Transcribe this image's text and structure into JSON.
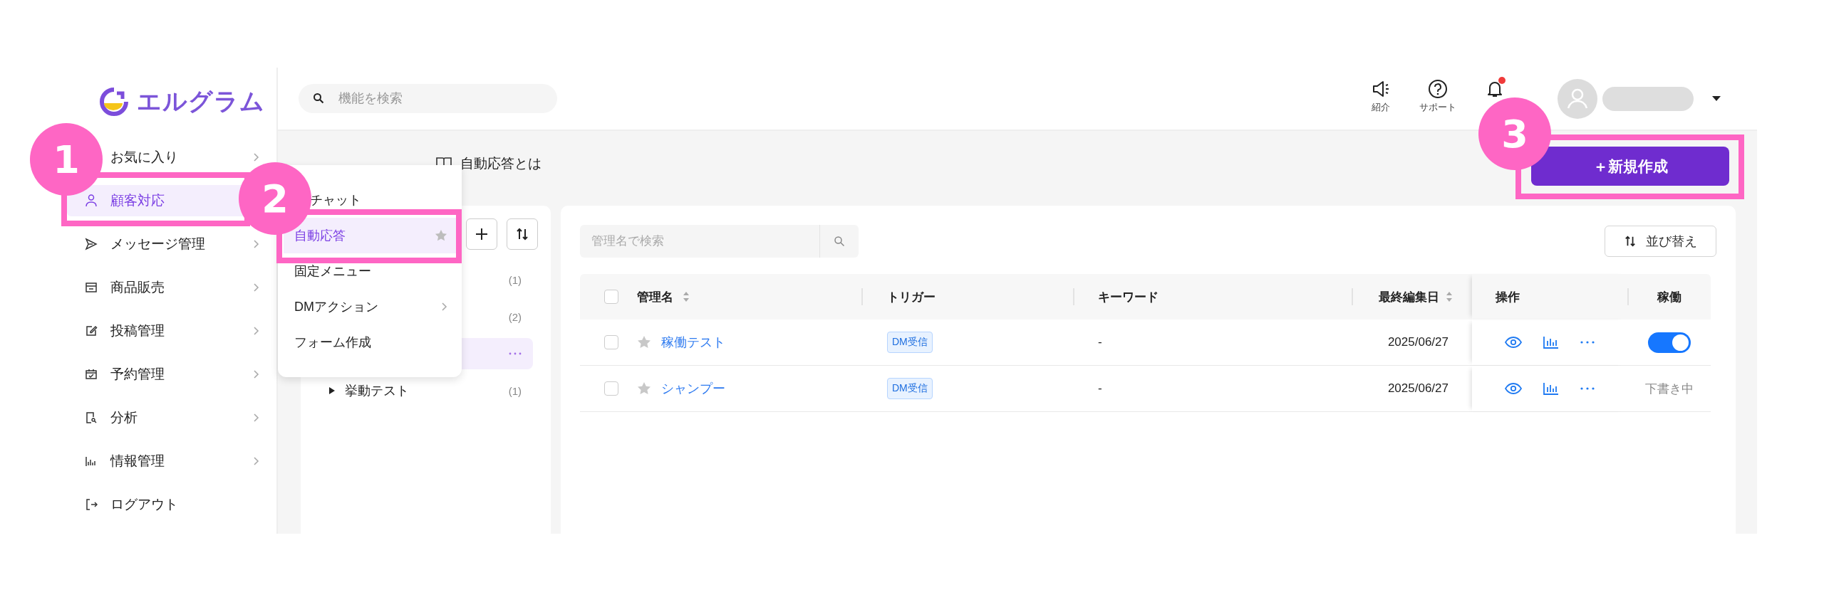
{
  "sidebar": {
    "logo": "エルグラム",
    "items": [
      {
        "label": "お気に入り",
        "selected": false,
        "has_submenu": true
      },
      {
        "label": "顧客対応",
        "selected": true
      },
      {
        "label": "メッセージ管理",
        "selected": false,
        "has_submenu": true
      },
      {
        "label": "商品販売",
        "selected": false,
        "has_submenu": true
      },
      {
        "label": "投稿管理",
        "selected": false,
        "has_submenu": true
      },
      {
        "label": "予約管理",
        "selected": false,
        "has_submenu": true
      },
      {
        "label": "分析",
        "selected": false,
        "has_submenu": true
      },
      {
        "label": "情報管理",
        "selected": false,
        "has_submenu": true
      },
      {
        "label": "ログアウト",
        "selected": false
      }
    ]
  },
  "header": {
    "search": {
      "placeholder": "機能を検索"
    },
    "tools": [
      {
        "label": "紹介"
      },
      {
        "label": "サポート"
      }
    ],
    "notifications": {
      "unread": true
    }
  },
  "flyout_menu": {
    "items": [
      {
        "label": "チャット",
        "selected": false
      },
      {
        "label": "自動応答",
        "selected": true,
        "favorite": false
      },
      {
        "label": "固定メニュー",
        "selected": false
      },
      {
        "label": "DMアクション",
        "selected": false,
        "has_submenu": true
      },
      {
        "label": "フォーム作成",
        "selected": false
      }
    ]
  },
  "page": {
    "help_link": "自動応答とは",
    "new_button": "＋新規作成"
  },
  "folders": [
    {
      "count": "(1)",
      "selected": false
    },
    {
      "count": "(2)",
      "selected": false
    },
    {
      "selected": true
    },
    {
      "label": "挙動テスト",
      "count": "(1)",
      "selected": false,
      "expanded": false
    }
  ],
  "list": {
    "search": {
      "placeholder": "管理名で検索"
    },
    "sort_button": "並び替え",
    "select_all_checked": false,
    "columns": [
      {
        "label": "管理名",
        "sortable": true
      },
      {
        "label": "トリガー",
        "sortable": false
      },
      {
        "label": "キーワード",
        "sortable": false
      },
      {
        "label": "最終編集日",
        "sortable": true
      },
      {
        "label": "操作",
        "sortable": false
      },
      {
        "label": "稼働",
        "sortable": false
      }
    ],
    "rows": [
      {
        "checked": false,
        "starred": false,
        "name": "稼働テスト",
        "trigger": "DM受信",
        "keyword": "-",
        "edited": "2025/06/27",
        "status": {
          "kind": "toggle",
          "on": true
        }
      },
      {
        "checked": false,
        "starred": false,
        "name": "シャンプー",
        "trigger": "DM受信",
        "keyword": "-",
        "edited": "2025/06/27",
        "status": {
          "kind": "text",
          "text": "下書き中"
        }
      }
    ]
  },
  "annotations": [
    {
      "number": "1"
    },
    {
      "number": "2"
    },
    {
      "number": "3"
    }
  ]
}
